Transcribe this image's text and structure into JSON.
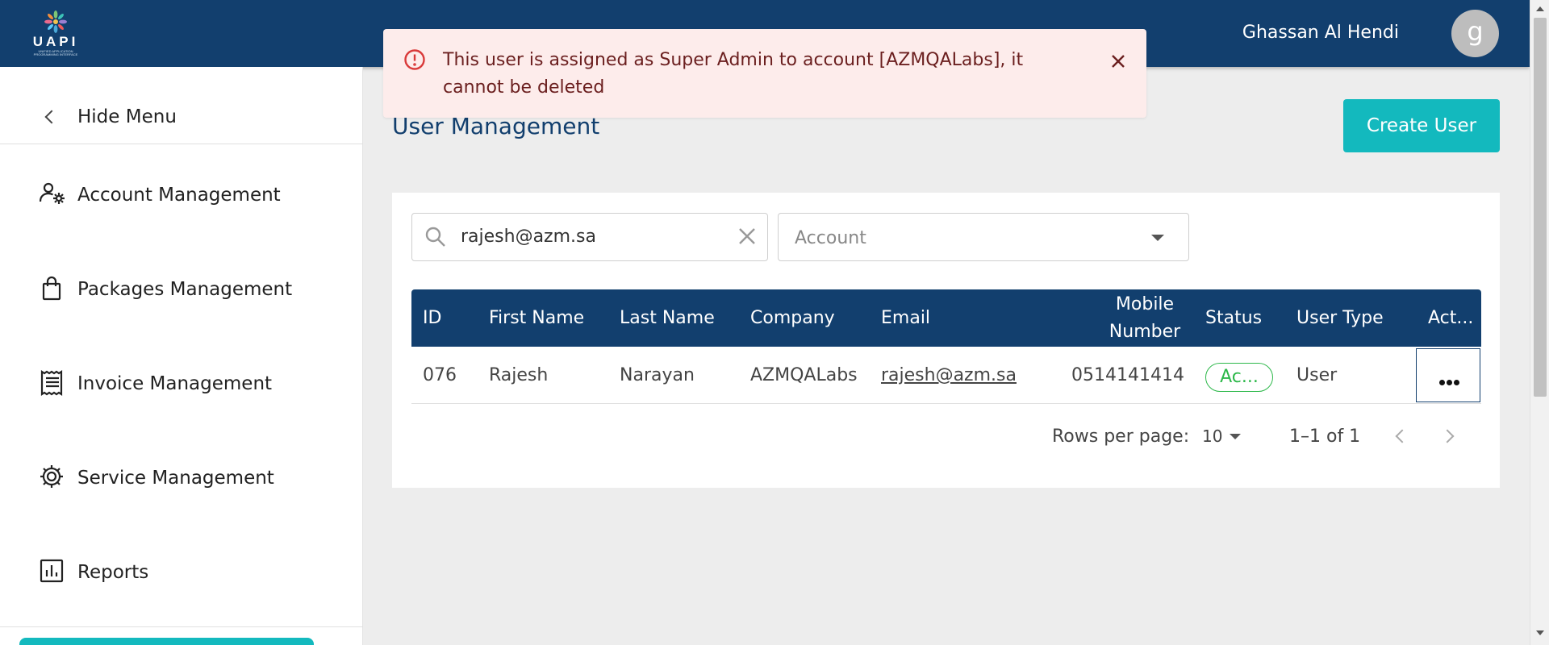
{
  "header": {
    "logo_text": "UAPI",
    "logo_subtitle": "UNIFIED APPLICATION PROGRAMMING INTERFACE",
    "user_name": "Ghassan Al Hendi",
    "avatar_initial": "g"
  },
  "alert": {
    "message": "This user is assigned as Super Admin to account [AZMQALabs], it cannot be deleted",
    "icon": "error-outline-icon",
    "color": "#fdeceb"
  },
  "sidebar": {
    "hide_menu_label": "Hide Menu",
    "items": [
      {
        "label": "Account Management",
        "icon": "user-settings-icon"
      },
      {
        "label": "Packages Management",
        "icon": "shopping-bag-icon"
      },
      {
        "label": "Invoice Management",
        "icon": "receipt-icon"
      },
      {
        "label": "Service Management",
        "icon": "gear-icon"
      },
      {
        "label": "Reports",
        "icon": "bar-chart-icon"
      }
    ]
  },
  "main": {
    "title": "User Management",
    "create_button_label": "Create User",
    "search": {
      "value": "rajesh@azm.sa"
    },
    "account_filter": {
      "placeholder": "Account"
    },
    "table": {
      "columns": [
        "ID",
        "First Name",
        "Last Name",
        "Company",
        "Email",
        "Mobile Number",
        "Status",
        "User Type",
        "Act..."
      ],
      "rows": [
        {
          "id": "076",
          "first_name": "Rajesh",
          "last_name": "Narayan",
          "company": "AZMQALabs",
          "email": "rajesh@azm.sa",
          "mobile": "0514141414",
          "status": "Ac...",
          "user_type": "User"
        }
      ]
    },
    "pagination": {
      "rows_per_page_label": "Rows per page:",
      "rows_per_page_value": "10",
      "range": "1–1 of 1"
    }
  },
  "colors": {
    "brand_navy": "#123f6e",
    "accent_teal": "#13b9be",
    "status_green": "#2db84a"
  }
}
